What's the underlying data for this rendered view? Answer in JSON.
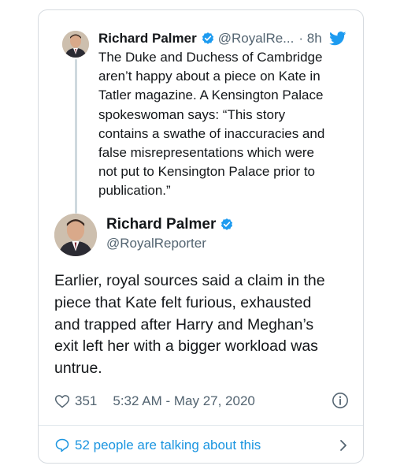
{
  "parent_tweet": {
    "author_name": "Richard Palmer",
    "handle": "@RoyalRe...",
    "time": "· 8h",
    "text": "The Duke and Duchess of Cambridge\naren’t happy about a piece on Kate in\nTatler magazine. A Kensington Palace\nspokeswoman says: “This story\ncontains a swathe of inaccuracies and\nfalse misrepresentations which were\nnot put to Kensington Palace prior to\npublication.”"
  },
  "main_tweet": {
    "author_name": "Richard Palmer",
    "handle": "@RoyalReporter",
    "text": "Earlier, royal sources said a claim in the\npiece that Kate felt furious, exhausted\nand trapped after Harry and Meghan’s\nexit left her with a bigger workload was\nuntrue.",
    "like_count": "351",
    "timestamp": "5:32 AM - May 27, 2020",
    "talking_text": "52 people are talking about this"
  },
  "colors": {
    "accent": "#1b95e0",
    "verified": "#1d9bf0",
    "secondary_text": "#536471",
    "border": "#d6dbe0"
  },
  "icons": {
    "verified": "verified-badge-icon",
    "bird": "twitter-bird-icon",
    "heart": "heart-icon",
    "info": "info-icon",
    "bubble": "speech-bubble-icon",
    "chevron": "chevron-right-icon"
  }
}
